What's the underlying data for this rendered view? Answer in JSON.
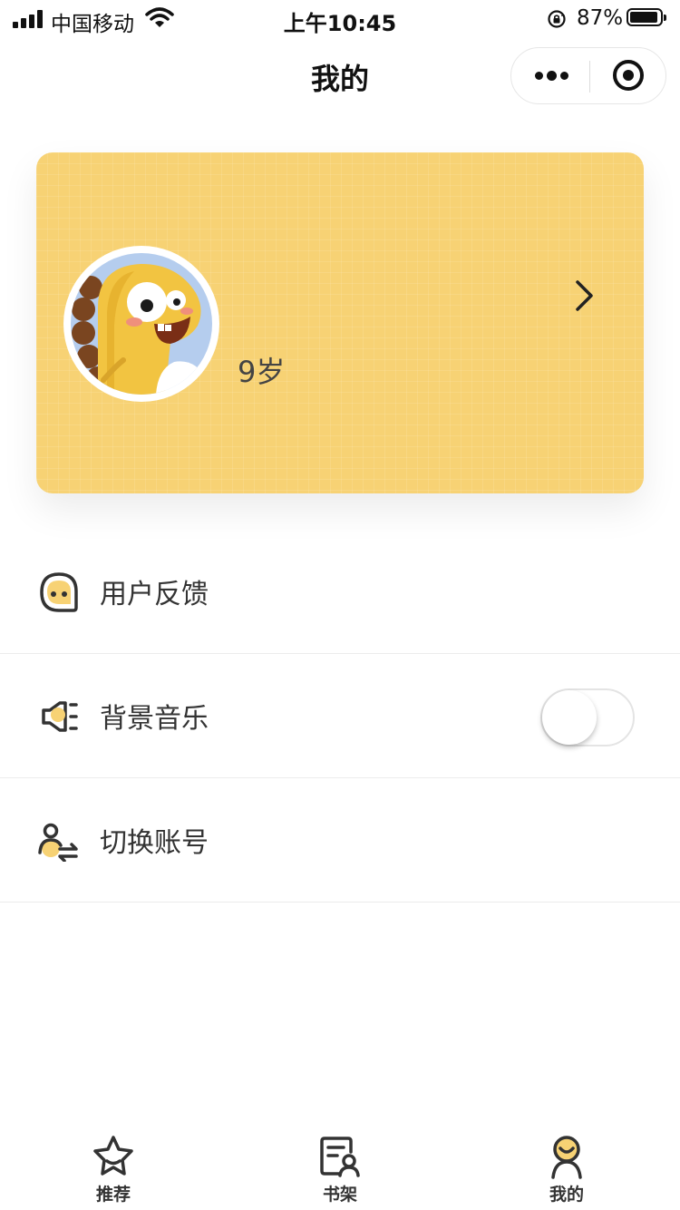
{
  "status_bar": {
    "carrier": "中国移动",
    "time": "上午10:45",
    "battery": "87%"
  },
  "nav": {
    "title": "我的"
  },
  "profile": {
    "age": "9岁",
    "card_color": "#f7d274"
  },
  "menu": {
    "feedback_label": "用户反馈",
    "music_label": "背景音乐",
    "music_enabled": false,
    "switch_account_label": "切换账号"
  },
  "tabs": {
    "recommend_label": "推荐",
    "bookshelf_label": "书架",
    "mine_label": "我的",
    "accent_color": "#f7d274"
  }
}
